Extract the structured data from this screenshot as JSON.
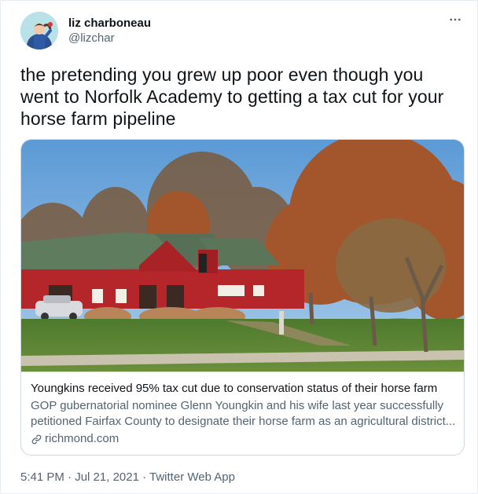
{
  "author": {
    "display_name": "liz charboneau",
    "handle": "@lizchar",
    "avatar_icon": "avatar-illustration"
  },
  "more_icon": "more-horizontal-icon",
  "tweet": {
    "text": "the pretending you grew up poor even though you went to Norfolk Academy to getting a tax cut for your horse farm pipeline"
  },
  "card": {
    "image_alt": "red barn-style house with green roof surrounded by trees and lawn",
    "title": "Youngkins received 95% tax cut due to conservation status of their horse farm",
    "description_line1": "GOP gubernatorial nominee Glenn Youngkin and his wife last year successfully",
    "description_line2": "petitioned Fairfax County to designate their horse farm as an agricultural district...",
    "domain": "richmond.com",
    "domain_icon": "link-icon"
  },
  "meta": {
    "time": "5:41 PM",
    "separator": " · ",
    "date": "Jul 21, 2021",
    "separator2": " · ",
    "source": "Twitter Web App"
  },
  "colors": {
    "text_primary": "#0f1419",
    "text_secondary": "#536471",
    "border": "#cfd9de",
    "roof_green": "#5f7d5e",
    "barn_red": "#b5262a"
  }
}
